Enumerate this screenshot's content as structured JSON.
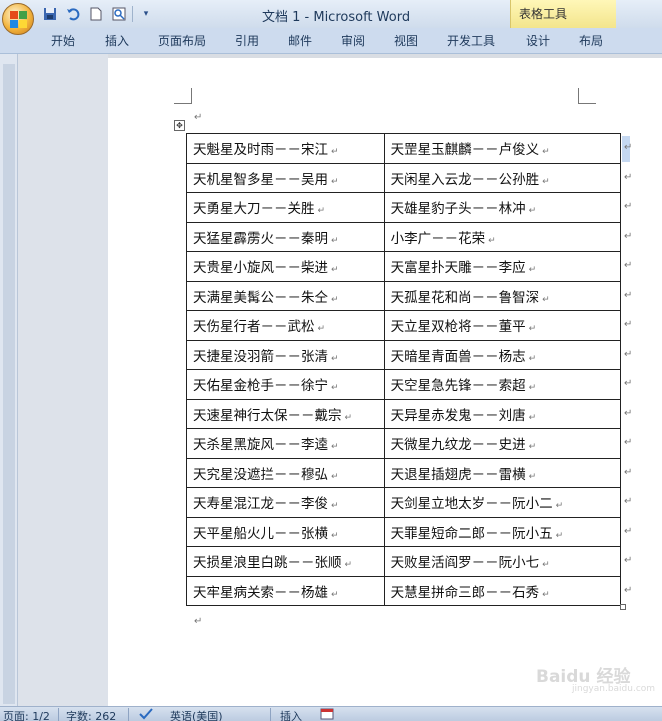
{
  "window": {
    "title": "文档 1 - Microsoft Word"
  },
  "context_tab": {
    "label": "表格工具"
  },
  "ribbon_tabs": [
    "开始",
    "插入",
    "页面布局",
    "引用",
    "邮件",
    "审阅",
    "视图",
    "开发工具",
    "设计",
    "布局"
  ],
  "table": {
    "rows": [
      [
        "天魁星及时雨－－宋江",
        "天罡星玉麒麟－－卢俊义"
      ],
      [
        "天机星智多星－－吴用",
        "天闲星入云龙－－公孙胜"
      ],
      [
        "天勇星大刀－－关胜",
        "天雄星豹子头－－林冲"
      ],
      [
        "天猛星霹雳火－－秦明",
        "小李广－－花荣"
      ],
      [
        "天贵星小旋风－－柴进",
        "天富星扑天雕－－李应"
      ],
      [
        "天满星美髯公－－朱仝",
        "天孤星花和尚－－鲁智深"
      ],
      [
        "天伤星行者－－武松",
        "天立星双枪将－－董平"
      ],
      [
        "天捷星没羽箭－－张清",
        "天暗星青面兽－－杨志"
      ],
      [
        "天佑星金枪手－－徐宁",
        "天空星急先锋－－索超"
      ],
      [
        "天速星神行太保－－戴宗",
        "天异星赤发鬼－－刘唐"
      ],
      [
        "天杀星黑旋风－－李逵",
        "天微星九纹龙－－史进"
      ],
      [
        "天究星没遮拦－－穆弘",
        "天退星插翅虎－－雷横"
      ],
      [
        "天寿星混江龙－－李俊",
        "天剑星立地太岁－－阮小二"
      ],
      [
        "天平星船火儿－－张横",
        "天罪星短命二郎－－阮小五"
      ],
      [
        "天损星浪里白跳－－张顺",
        "天败星活阎罗－－阮小七"
      ],
      [
        "天牢星病关索－－杨雄",
        "天慧星拼命三郎－－石秀"
      ]
    ]
  },
  "marks": {
    "paragraph": "↵",
    "move": "✥"
  },
  "watermark": {
    "brand": "Baidu 经验",
    "url": "jingyan.baidu.com"
  },
  "status": {
    "page": "页面: 1/2",
    "words": "字数: 262",
    "language": "英语(美国)",
    "mode": "插入"
  }
}
